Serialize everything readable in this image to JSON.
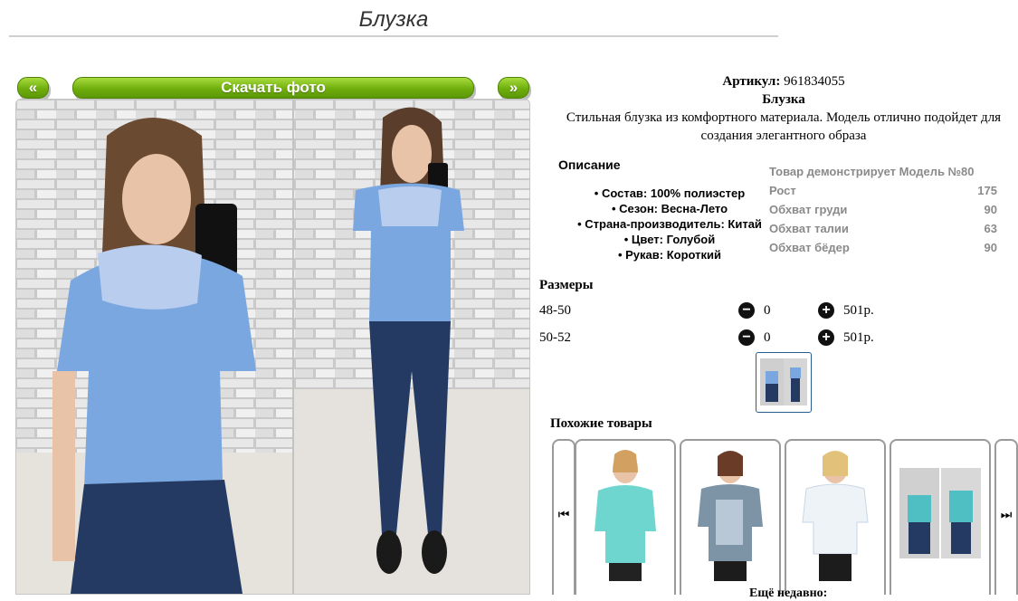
{
  "page": {
    "title": "Блузка"
  },
  "gallery": {
    "prev_label": "«",
    "next_label": "»",
    "download_label": "Скачать фото"
  },
  "product": {
    "article_label": "Артикул:",
    "article_value": "961834055",
    "name": "Блузка",
    "tagline_1": "Стильная блузка из комфортного материала. Модель отлично подойдет для",
    "tagline_2": "создания элегантного образа"
  },
  "description": {
    "heading": "Описание",
    "items": [
      "Состав: 100% полиэстер",
      "Сезон: Весна-Лето",
      "Страна-производитель: Китай",
      "Цвет: Голубой",
      "Рукав: Короткий"
    ]
  },
  "model": {
    "heading": "Товар демонстрирует Модель №80",
    "rows": [
      {
        "label": "Рост",
        "value": "175"
      },
      {
        "label": "Обхват груди",
        "value": "90"
      },
      {
        "label": "Обхват талии",
        "value": "63"
      },
      {
        "label": "Обхват бёдер",
        "value": "90"
      }
    ]
  },
  "sizes": {
    "heading": "Размеры",
    "rows": [
      {
        "size": "48-50",
        "qty": "0",
        "price": "501р."
      },
      {
        "size": "50-52",
        "qty": "0",
        "price": "501р."
      }
    ],
    "minus_icon": "minus-circle-icon",
    "plus_icon": "plus-circle-icon"
  },
  "similar": {
    "heading": "Похожие товары",
    "prev_icon": "skip-back-icon",
    "next_icon": "skip-forward-icon",
    "items": [
      {
        "color": "#6fd6cf"
      },
      {
        "color": "#7d93a6"
      },
      {
        "color": "#eef3f8"
      },
      {
        "color": "#4fbfc4"
      }
    ]
  },
  "more_label": "Ещё недавно:",
  "colors": {
    "accent_green": "#6fae0d",
    "blouse_blue": "#7aa7e0",
    "jeans": "#243a63"
  }
}
